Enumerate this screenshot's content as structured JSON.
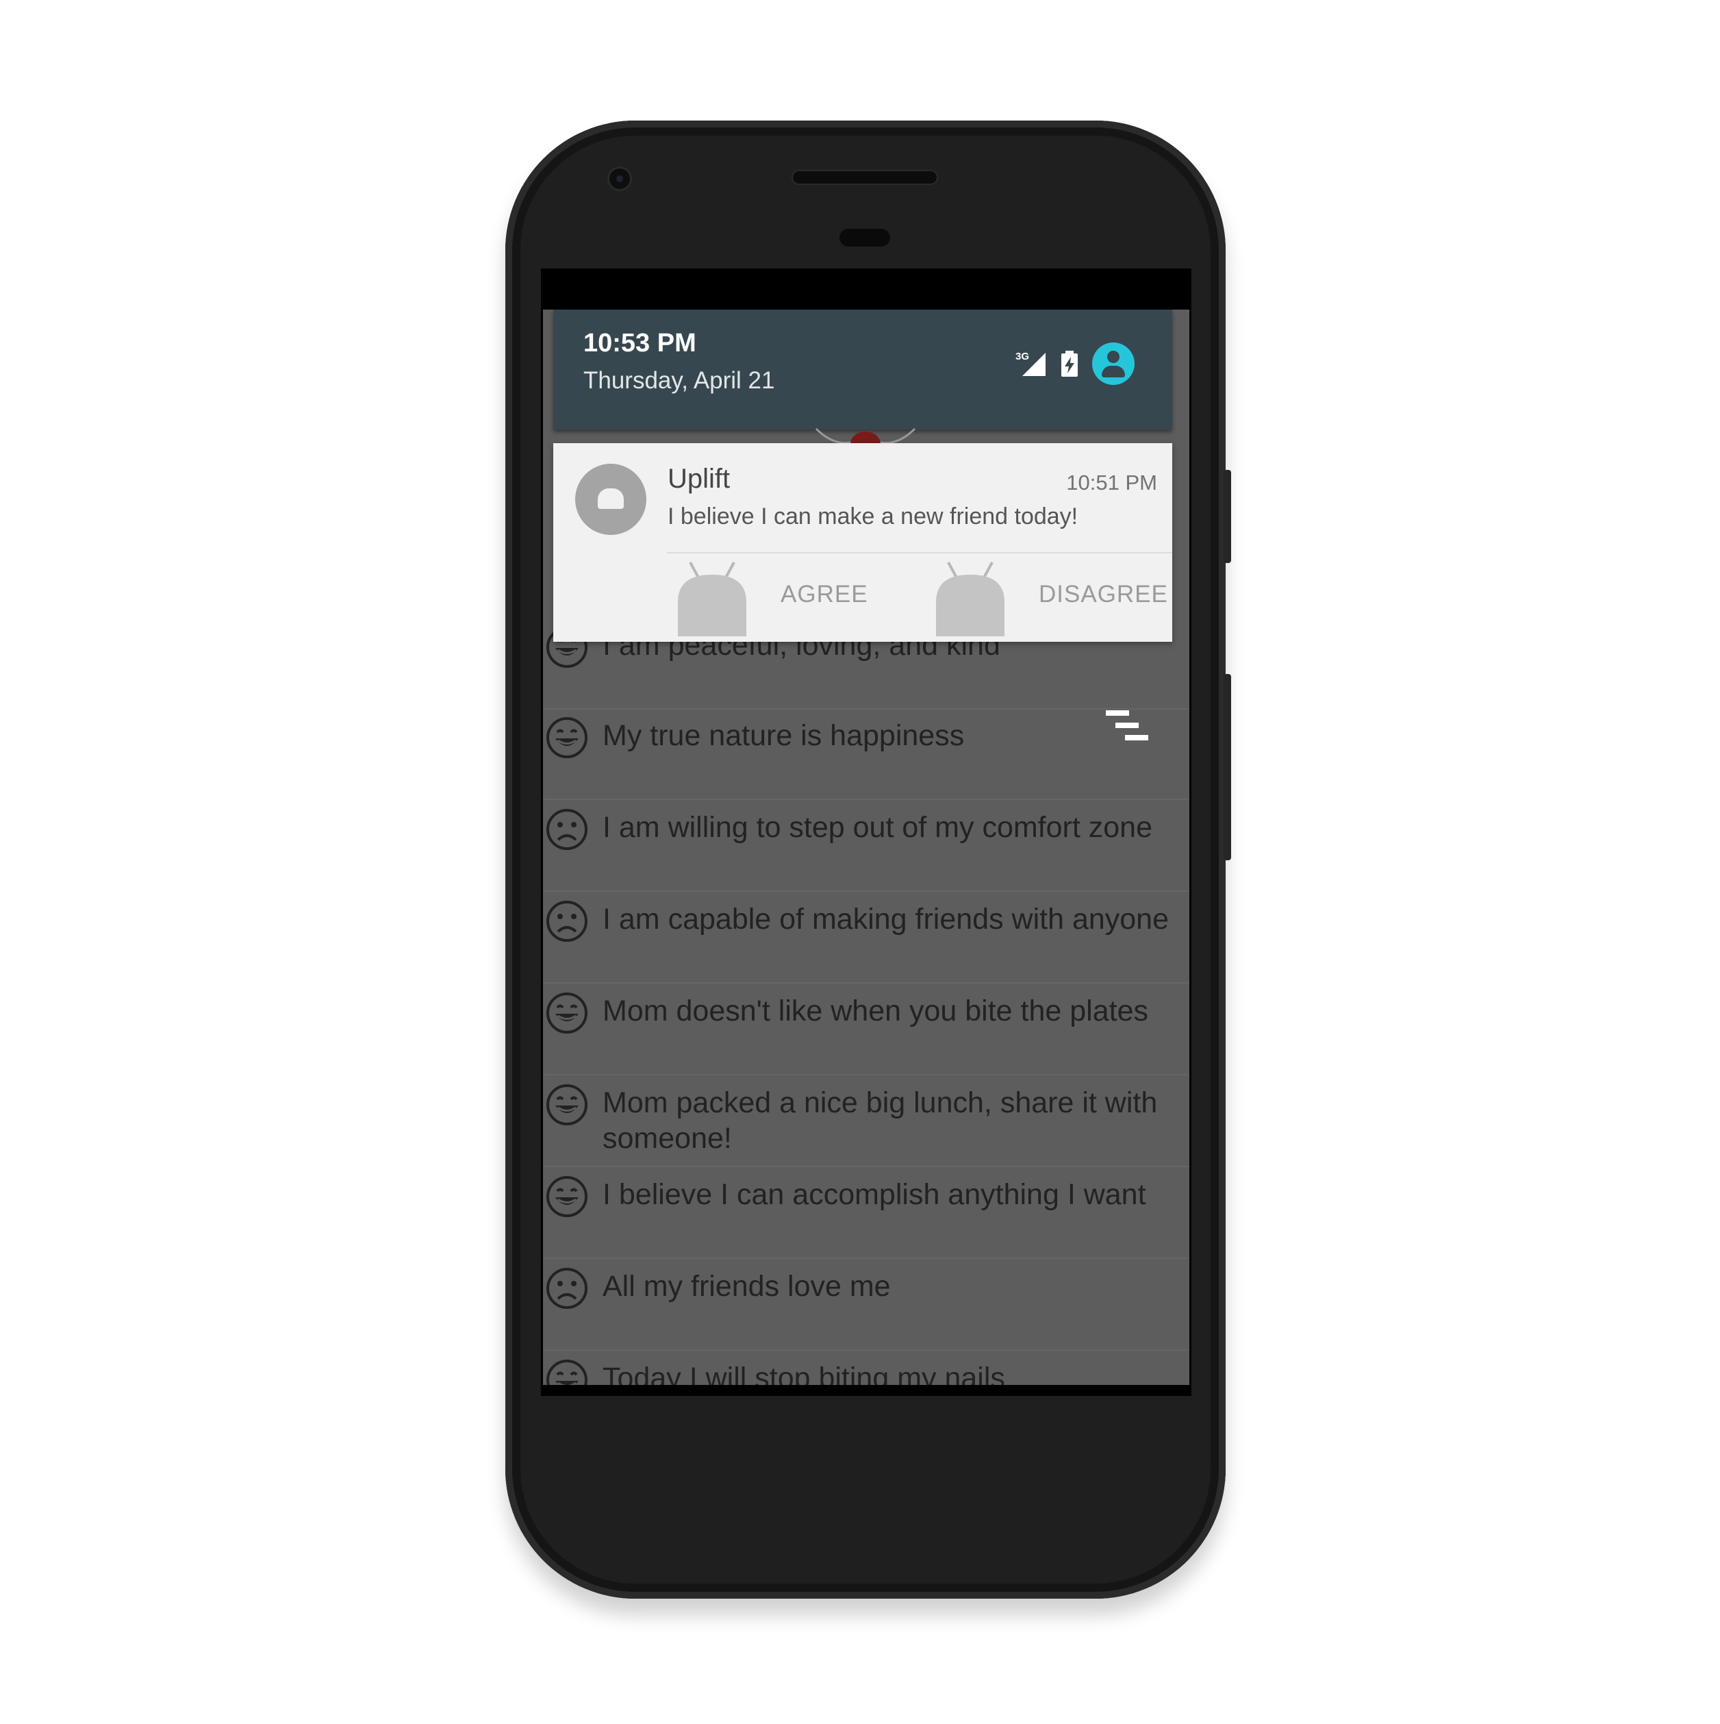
{
  "status_shade": {
    "time": "10:53 PM",
    "date": "Thursday, April 21",
    "network_type": "3G",
    "icons": [
      "signal-3g-icon",
      "battery-charging-icon",
      "account-icon"
    ]
  },
  "notification": {
    "app_name": "Uplift",
    "time": "10:51 PM",
    "message": "I believe I can make a new friend today!",
    "actions": {
      "agree_label": "AGREE",
      "disagree_label": "DISAGREE"
    }
  },
  "affirmations": [
    {
      "text": "I am peaceful, loving, and kind",
      "mood": "happy"
    },
    {
      "text": "My true nature is happiness",
      "mood": "happy"
    },
    {
      "text": "I am willing to step out of my comfort zone",
      "mood": "sad"
    },
    {
      "text": "I am capable of making friends with anyone",
      "mood": "sad"
    },
    {
      "text": "Mom doesn't like when you bite the plates",
      "mood": "happy"
    },
    {
      "text": "Mom packed a nice big lunch, share it with someone!",
      "mood": "happy"
    },
    {
      "text": "I believe I can accomplish anything I want",
      "mood": "happy"
    },
    {
      "text": "All my friends love me",
      "mood": "sad"
    },
    {
      "text": "Today I will stop biting my nails",
      "mood": "happy"
    }
  ],
  "colors": {
    "shade_header": "#37474f",
    "accent": "#26c6da",
    "list_background": "#5d5d5d",
    "notification_background": "#f1f1f1"
  }
}
